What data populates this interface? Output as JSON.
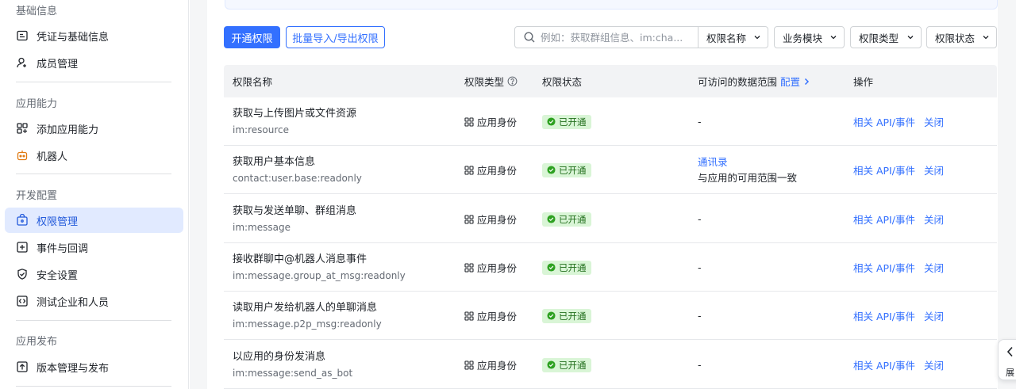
{
  "sidebar": {
    "groups": [
      {
        "title": "基础信息",
        "items": [
          {
            "label": "凭证与基础信息",
            "icon": "credential-icon",
            "active": false
          },
          {
            "label": "成员管理",
            "icon": "member-icon",
            "active": false
          }
        ]
      },
      {
        "title": "应用能力",
        "items": [
          {
            "label": "添加应用能力",
            "icon": "add-capability-icon",
            "active": false
          },
          {
            "label": "机器人",
            "icon": "robot-icon",
            "active": false
          }
        ]
      },
      {
        "title": "开发配置",
        "items": [
          {
            "label": "权限管理",
            "icon": "permission-icon",
            "active": true
          },
          {
            "label": "事件与回调",
            "icon": "event-icon",
            "active": false
          },
          {
            "label": "安全设置",
            "icon": "shield-icon",
            "active": false
          },
          {
            "label": "测试企业和人员",
            "icon": "code-icon",
            "active": false
          }
        ]
      },
      {
        "title": "应用发布",
        "items": [
          {
            "label": "版本管理与发布",
            "icon": "upload-icon",
            "active": false
          }
        ]
      }
    ]
  },
  "toolbar": {
    "primary_button": "开通权限",
    "outline_button": "批量导入/导出权限",
    "search_placeholder": "例如：获取群组信息、im:cha...",
    "search_field": "权限名称",
    "filters": [
      "业务模块",
      "权限类型",
      "权限状态"
    ]
  },
  "table": {
    "headers": {
      "name": "权限名称",
      "type": "权限类型",
      "status": "权限状态",
      "scope": "可访问的数据范围",
      "scope_link": "配置",
      "ops": "操作"
    },
    "rows": [
      {
        "name": "获取与上传图片或文件资源",
        "key": "im:resource",
        "type": "应用身份",
        "status": "已开通",
        "scope_link": "",
        "scope_text": "-",
        "op1": "相关 API/事件",
        "op2": "关闭"
      },
      {
        "name": "获取用户基本信息",
        "key": "contact:user.base:readonly",
        "type": "应用身份",
        "status": "已开通",
        "scope_link": "通讯录",
        "scope_text": "与应用的可用范围一致",
        "op1": "相关 API/事件",
        "op2": "关闭"
      },
      {
        "name": "获取与发送单聊、群组消息",
        "key": "im:message",
        "type": "应用身份",
        "status": "已开通",
        "scope_link": "",
        "scope_text": "-",
        "op1": "相关 API/事件",
        "op2": "关闭"
      },
      {
        "name": "接收群聊中@机器人消息事件",
        "key": "im:message.group_at_msg:readonly",
        "type": "应用身份",
        "status": "已开通",
        "scope_link": "",
        "scope_text": "-",
        "op1": "相关 API/事件",
        "op2": "关闭"
      },
      {
        "name": "读取用户发给机器人的单聊消息",
        "key": "im:message.p2p_msg:readonly",
        "type": "应用身份",
        "status": "已开通",
        "scope_link": "",
        "scope_text": "-",
        "op1": "相关 API/事件",
        "op2": "关闭"
      },
      {
        "name": "以应用的身份发消息",
        "key": "im:message:send_as_bot",
        "type": "应用身份",
        "status": "已开通",
        "scope_link": "",
        "scope_text": "-",
        "op1": "相关 API/事件",
        "op2": "关闭"
      }
    ]
  },
  "float_handle": {
    "label": "展"
  },
  "colors": {
    "accent": "#3370ff",
    "active_bg": "#e1eaff",
    "badge_bg": "#d9f5d6",
    "badge_text": "#24701f"
  }
}
